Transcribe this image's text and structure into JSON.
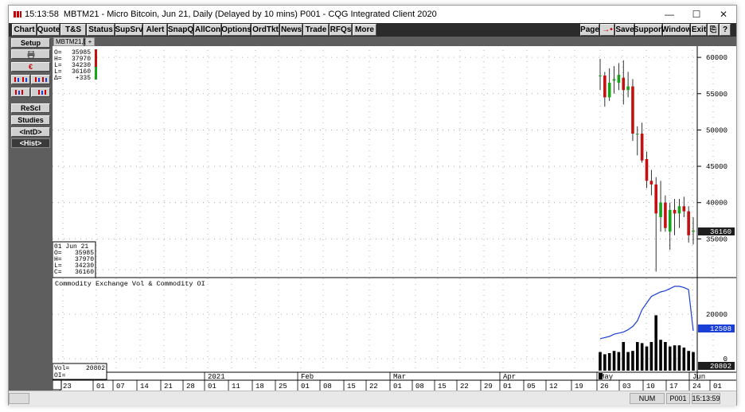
{
  "titlebar": {
    "time": "15:13:58",
    "title": "MBTM21 - Micro Bitcoin, Jun 21, Daily (Delayed by 10 mins)  P001 - CQG Integrated Client 2020",
    "minimize": "—",
    "maximize": "☐",
    "close": "✕"
  },
  "toolbar": {
    "left": [
      "Chart",
      "Quote",
      "T&S",
      "Status",
      "SupSrv",
      "Alert",
      "SnapQ",
      "AllCon",
      "Options",
      "OrdTkt",
      "News",
      "Trade",
      "RFQs",
      "More"
    ],
    "right": [
      "Page",
      "→•",
      "Save",
      "Support",
      "Window",
      "Exit",
      "⎘",
      "?"
    ]
  },
  "leftpanel": {
    "setup": "Setup",
    "print_icon": "printer-icon",
    "euro": "€",
    "rescl": "ReScl",
    "studies": "Studies",
    "intd": "<IntD>",
    "hist": "<Hist>"
  },
  "tabs": {
    "symbol": "MBTM21,D",
    "add": "+"
  },
  "price_panel": {
    "ohlc_box": {
      "o_label": "O=",
      "o": "35985",
      "h_label": "H=",
      "h": "37970",
      "l_label": "L=",
      "l": "34230",
      "c_label": "L=",
      "c": "36160",
      "d_label": "Δ=",
      "d": "+335"
    },
    "bottom_box": {
      "date": "01 Jun 21",
      "o_label": "O=",
      "o": "35985",
      "h_label": "H=",
      "h": "37970",
      "l_label": "L=",
      "l": "34230",
      "c_label": "C=",
      "c": "36160"
    },
    "yticks": [
      "60000",
      "55000",
      "50000",
      "45000",
      "40000",
      "35000"
    ],
    "last_price": "36160"
  },
  "volume_panel": {
    "title": "Commodity Exchange Vol & Commodity OI",
    "vol_label": "Vol=",
    "vol": "20802",
    "oi_label": "OI=",
    "yticks": [
      "20000",
      "0"
    ],
    "oi_value": "12508",
    "vol_value": "20802"
  },
  "xaxis": {
    "labels": [
      "23",
      "01",
      "07",
      "14",
      "21",
      "28",
      "01",
      "11",
      "18",
      "25",
      "01",
      "08",
      "15",
      "22",
      "01",
      "08",
      "15",
      "22",
      "29",
      "01",
      "05",
      "12",
      "19",
      "26",
      "03",
      "10",
      "17",
      "24",
      "01"
    ],
    "months": [
      "2021",
      "Feb",
      "Mar",
      "Apr",
      "May",
      "Jun"
    ]
  },
  "statusbar": {
    "num": "NUM",
    "page": "P001",
    "time": "15:13:59"
  },
  "colors": {
    "up": "#18a318",
    "down": "#c41010",
    "oi_line": "#1a3fd6",
    "volume": "#000000"
  },
  "chart_data": [
    {
      "type": "candlestick",
      "series_name": "MBTM21",
      "x": [
        "May 03",
        "May 04",
        "May 05",
        "May 06",
        "May 07",
        "May 10",
        "May 11",
        "May 12",
        "May 13",
        "May 14",
        "May 17",
        "May 18",
        "May 19",
        "May 20",
        "May 21",
        "May 24",
        "May 25",
        "May 26",
        "May 27",
        "May 28",
        "Jun 01"
      ],
      "open": [
        57500,
        57500,
        54500,
        56800,
        56500,
        57200,
        55500,
        56000,
        49500,
        49500,
        46000,
        43000,
        42500,
        38000,
        40000,
        36000,
        39000,
        38500,
        39500,
        38800,
        35985
      ],
      "high": [
        59800,
        58000,
        58500,
        58800,
        59200,
        59600,
        58000,
        57000,
        50500,
        51000,
        47000,
        44500,
        43500,
        43000,
        41000,
        40000,
        40500,
        40500,
        40800,
        39500,
        37970
      ],
      "low": [
        55500,
        53200,
        54000,
        55000,
        55500,
        53500,
        54500,
        48500,
        46500,
        45500,
        42000,
        41000,
        30500,
        36000,
        36000,
        33500,
        35500,
        36500,
        38000,
        34500,
        34230
      ],
      "close": [
        57500,
        54500,
        56500,
        57000,
        57600,
        55500,
        56000,
        49500,
        49500,
        45800,
        43000,
        42500,
        38500,
        40000,
        36500,
        39000,
        38500,
        39500,
        38800,
        35500,
        36160
      ],
      "ylim": [
        30000,
        61000
      ]
    },
    {
      "type": "bar",
      "series_name": "Volume",
      "values": [
        3000,
        2000,
        2500,
        3500,
        3000,
        7500,
        3000,
        3500,
        7500,
        7000,
        5500,
        7500,
        19500,
        8500,
        7500,
        5500,
        6000,
        6000,
        5000,
        3500,
        3000
      ]
    },
    {
      "type": "line",
      "series_name": "Open Interest",
      "values": [
        9000,
        9500,
        10000,
        11000,
        11500,
        12000,
        13000,
        14500,
        17000,
        22000,
        25000,
        28000,
        29000,
        30000,
        30500,
        31500,
        32500,
        32500,
        32000,
        31000,
        12508
      ]
    }
  ]
}
